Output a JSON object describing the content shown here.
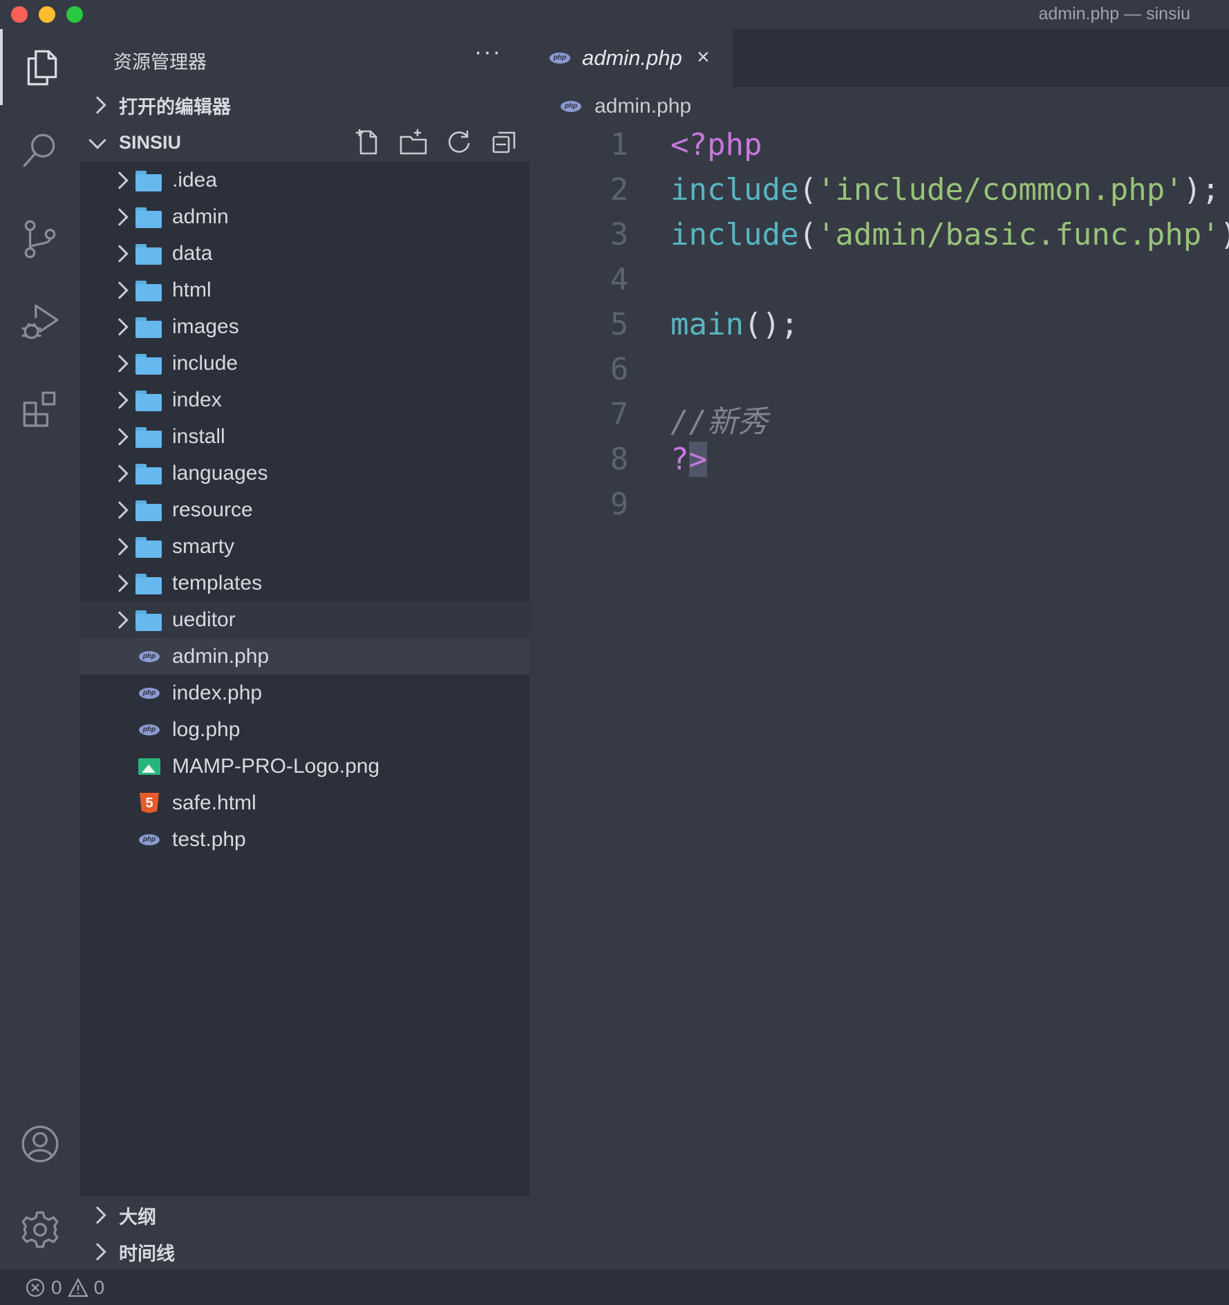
{
  "window": {
    "title": "admin.php — sinsiu"
  },
  "activity_bar": {
    "items": [
      {
        "name": "explorer",
        "icon": "files-icon",
        "active": true
      },
      {
        "name": "search",
        "icon": "search-icon"
      },
      {
        "name": "source-control",
        "icon": "source-control-icon"
      },
      {
        "name": "run-debug",
        "icon": "run-debug-icon"
      },
      {
        "name": "extensions",
        "icon": "extensions-icon"
      }
    ],
    "bottom": [
      {
        "name": "accounts",
        "icon": "account-icon"
      },
      {
        "name": "manage",
        "icon": "gear-icon"
      }
    ]
  },
  "sidebar": {
    "title": "资源管理器",
    "more": "···",
    "open_editors": "打开的编辑器",
    "project": "SINSIU",
    "project_tools": [
      "new-file-icon",
      "new-folder-icon",
      "refresh-icon",
      "collapse-all-icon"
    ],
    "folders": [
      ".idea",
      "admin",
      "data",
      "html",
      "images",
      "include",
      "index",
      "install",
      "languages",
      "resource",
      "smarty",
      "templates",
      "ueditor"
    ],
    "files": [
      {
        "name": "admin.php",
        "icon": "php-file-icon",
        "selected": true
      },
      {
        "name": "index.php",
        "icon": "php-file-icon"
      },
      {
        "name": "log.php",
        "icon": "php-file-icon"
      },
      {
        "name": "MAMP-PRO-Logo.png",
        "icon": "image-file-icon"
      },
      {
        "name": "safe.html",
        "icon": "html-file-icon"
      },
      {
        "name": "test.php",
        "icon": "php-file-icon"
      }
    ],
    "outline": "大纲",
    "timeline": "时间线"
  },
  "editor": {
    "tab": {
      "label": "admin.php",
      "close": "×"
    },
    "breadcrumb": "admin.php",
    "line_numbers": [
      "1",
      "2",
      "3",
      "4",
      "5",
      "6",
      "7",
      "8",
      "9"
    ],
    "lines": {
      "l1": "<?php",
      "l2_fn": "include",
      "l2_open": "(",
      "l2_str": "'include/common.php'",
      "l2_close": ");",
      "l3_fn": "include",
      "l3_open": "(",
      "l3_str": "'admin/basic.func.php'",
      "l3_close": ")",
      "l5_fn": "main",
      "l5_rest": "();",
      "l7": "//新秀",
      "l8_q": "?",
      "l8_gt": ">"
    }
  },
  "status_bar": {
    "errors": "0",
    "warnings": "0"
  },
  "colors": {
    "background": "#363a44",
    "tree": "#2c303a",
    "keyword": "#c678dd",
    "function": "#56b6c2",
    "string": "#98c379",
    "comment": "#7f848e"
  }
}
